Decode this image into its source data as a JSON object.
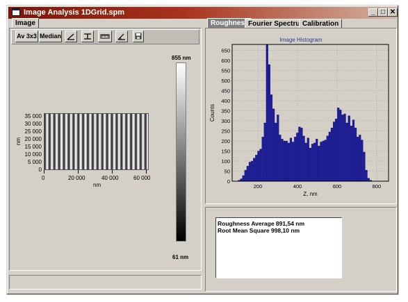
{
  "window": {
    "title": "Image Analysis 1DGrid.spm"
  },
  "caption_buttons": {
    "minimize": "_",
    "maximize": "□",
    "close": "✕"
  },
  "left_panel": {
    "tab": "Image",
    "toolbar": {
      "av_label": "Av 3x3",
      "median_label": "Median",
      "icons": [
        "plane-tilt-icon",
        "line-level-icon",
        "ruler-icon",
        "angle-icon",
        "save-icon"
      ]
    },
    "image_axes": {
      "y_ticks": [
        "35 000",
        "30 000",
        "25 000",
        "20 000",
        "15 000",
        "10 000",
        "5 000",
        "0"
      ],
      "y_label": "nm",
      "x_ticks": [
        "0",
        "20 000",
        "40 000",
        "60 000"
      ],
      "x_label": "nm"
    },
    "colorbar": {
      "max_label": "855 nm",
      "min_label": "61 nm"
    }
  },
  "right_panel": {
    "tabs": [
      "Roughness",
      "Fourier Spectrum",
      "Calibration"
    ],
    "active_tab": "Roughness",
    "results": {
      "line1": "Roughness Average   891,54 nm",
      "line2": "Root Mean Square    998,10 nm"
    }
  },
  "chart_data": {
    "type": "bar",
    "title": "Image Histogram",
    "xlabel": "Z, nm",
    "ylabel": "Counts",
    "xlim": [
      70,
      860
    ],
    "ylim": [
      0,
      680
    ],
    "x_ticks": [
      200,
      400,
      600,
      800
    ],
    "y_ticks": [
      0,
      50,
      100,
      150,
      200,
      250,
      300,
      350,
      400,
      450,
      500,
      550,
      600,
      650
    ],
    "grid": true,
    "bin_start": 100,
    "bin_width": 10.9,
    "values": [
      5,
      12,
      28,
      55,
      75,
      95,
      100,
      115,
      130,
      150,
      160,
      220,
      290,
      680,
      580,
      430,
      360,
      290,
      330,
      230,
      210,
      200,
      200,
      190,
      215,
      195,
      220,
      240,
      270,
      265,
      225,
      190,
      215,
      165,
      185,
      190,
      210,
      175,
      195,
      200,
      205,
      225,
      245,
      265,
      295,
      310,
      365,
      355,
      330,
      335,
      290,
      325,
      275,
      305,
      265,
      220,
      230,
      205,
      145,
      55,
      15,
      5
    ]
  }
}
